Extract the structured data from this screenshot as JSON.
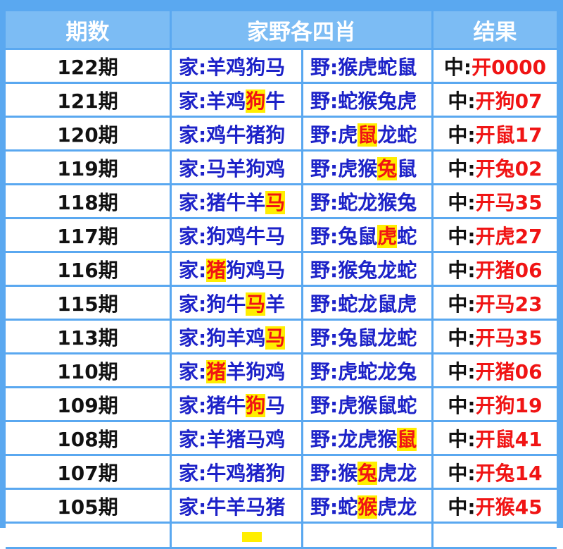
{
  "header": {
    "col_period": "期数",
    "col_groups": "家野各四肖",
    "col_result": "结果"
  },
  "labels": {
    "home_prefix": "家:",
    "wild_prefix": "野:",
    "result_prefix": "中:"
  },
  "colors": {
    "frame": "#5aa8f0",
    "header_bg": "#7cbcf4",
    "zodiac_blue": "#1d22c8",
    "result_red": "#f01414",
    "highlight": "#ffee00"
  },
  "rows": [
    {
      "period": "122期",
      "home": [
        "羊",
        "鸡",
        "狗",
        "马"
      ],
      "wild": [
        "猴",
        "虎",
        "蛇",
        "鼠"
      ],
      "hit_side": "",
      "hit_index": -1,
      "result": "开0000"
    },
    {
      "period": "121期",
      "home": [
        "羊",
        "鸡",
        "狗",
        "牛"
      ],
      "wild": [
        "蛇",
        "猴",
        "兔",
        "虎"
      ],
      "hit_side": "home",
      "hit_index": 2,
      "result": "开狗07"
    },
    {
      "period": "120期",
      "home": [
        "鸡",
        "牛",
        "猪",
        "狗"
      ],
      "wild": [
        "虎",
        "鼠",
        "龙",
        "蛇"
      ],
      "hit_side": "wild",
      "hit_index": 1,
      "result": "开鼠17"
    },
    {
      "period": "119期",
      "home": [
        "马",
        "羊",
        "狗",
        "鸡"
      ],
      "wild": [
        "虎",
        "猴",
        "兔",
        "鼠"
      ],
      "hit_side": "wild",
      "hit_index": 2,
      "result": "开兔02"
    },
    {
      "period": "118期",
      "home": [
        "猪",
        "牛",
        "羊",
        "马"
      ],
      "wild": [
        "蛇",
        "龙",
        "猴",
        "兔"
      ],
      "hit_side": "home",
      "hit_index": 3,
      "result": "开马35"
    },
    {
      "period": "117期",
      "home": [
        "狗",
        "鸡",
        "牛",
        "马"
      ],
      "wild": [
        "兔",
        "鼠",
        "虎",
        "蛇"
      ],
      "hit_side": "wild",
      "hit_index": 2,
      "result": "开虎27"
    },
    {
      "period": "116期",
      "home": [
        "猪",
        "狗",
        "鸡",
        "马"
      ],
      "wild": [
        "猴",
        "兔",
        "龙",
        "蛇"
      ],
      "hit_side": "home",
      "hit_index": 0,
      "result": "开猪06"
    },
    {
      "period": "115期",
      "home": [
        "狗",
        "牛",
        "马",
        "羊"
      ],
      "wild": [
        "蛇",
        "龙",
        "鼠",
        "虎"
      ],
      "hit_side": "home",
      "hit_index": 2,
      "result": "开马23"
    },
    {
      "period": "113期",
      "home": [
        "狗",
        "羊",
        "鸡",
        "马"
      ],
      "wild": [
        "兔",
        "鼠",
        "龙",
        "蛇"
      ],
      "hit_side": "home",
      "hit_index": 3,
      "result": "开马35"
    },
    {
      "period": "110期",
      "home": [
        "猪",
        "羊",
        "狗",
        "鸡"
      ],
      "wild": [
        "虎",
        "蛇",
        "龙",
        "兔"
      ],
      "hit_side": "home",
      "hit_index": 0,
      "result": "开猪06"
    },
    {
      "period": "109期",
      "home": [
        "猪",
        "牛",
        "狗",
        "马"
      ],
      "wild": [
        "虎",
        "猴",
        "鼠",
        "蛇"
      ],
      "hit_side": "home",
      "hit_index": 2,
      "result": "开狗19"
    },
    {
      "period": "108期",
      "home": [
        "羊",
        "猪",
        "马",
        "鸡"
      ],
      "wild": [
        "龙",
        "虎",
        "猴",
        "鼠"
      ],
      "hit_side": "wild",
      "hit_index": 3,
      "result": "开鼠41"
    },
    {
      "period": "107期",
      "home": [
        "牛",
        "鸡",
        "猪",
        "狗"
      ],
      "wild": [
        "猴",
        "兔",
        "虎",
        "龙"
      ],
      "hit_side": "wild",
      "hit_index": 1,
      "result": "开兔14"
    },
    {
      "period": "105期",
      "home": [
        "牛",
        "羊",
        "马",
        "猪"
      ],
      "wild": [
        "蛇",
        "猴",
        "虎",
        "龙"
      ],
      "hit_side": "wild",
      "hit_index": 1,
      "result": "开猴45"
    }
  ]
}
